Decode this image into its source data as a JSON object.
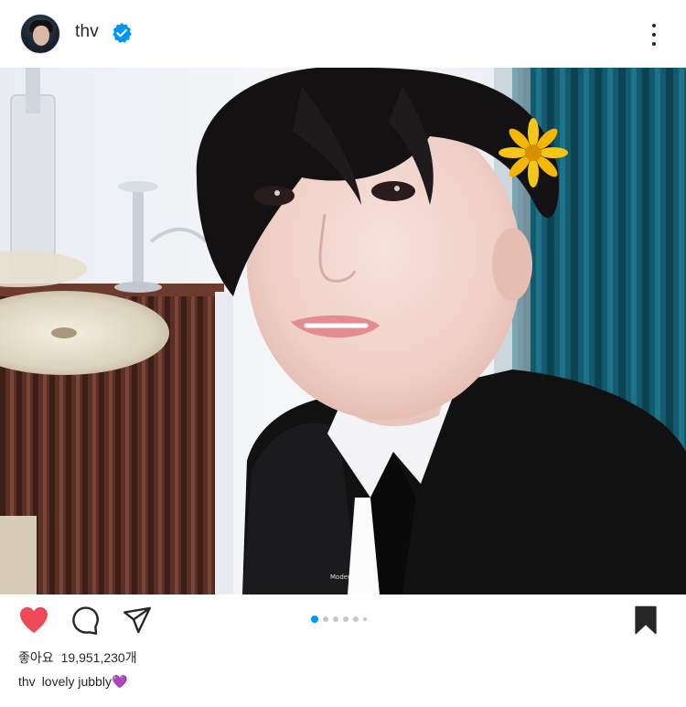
{
  "header": {
    "username": "thv",
    "verified": true,
    "avatar_icon": "profile-avatar",
    "more_icon": "more-vertical-icon"
  },
  "photo": {
    "description_icon": "post-photo",
    "watermark": "Modeun"
  },
  "actions": {
    "like_icon": "heart-filled-icon",
    "comment_icon": "comment-icon",
    "share_icon": "send-icon",
    "save_icon": "bookmark-filled-icon",
    "carousel_total": 6,
    "carousel_active": 1
  },
  "likes": {
    "label": "좋아요",
    "count": "19,951,230개"
  },
  "caption": {
    "username": "thv",
    "text": "lovely jubbly💜"
  },
  "colors": {
    "like_red": "#ed4956",
    "verified_blue": "#0095f6",
    "active_dot": "#0095f6",
    "text": "#262626"
  }
}
